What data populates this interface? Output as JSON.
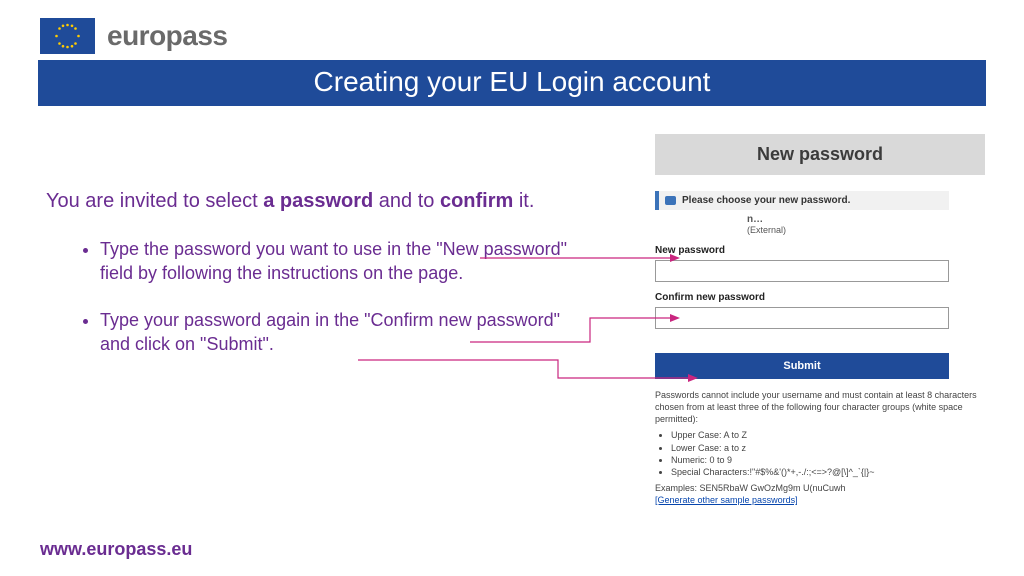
{
  "brand": "europass",
  "title": "Creating your EU Login account",
  "intro": {
    "pre": "You are invited to select ",
    "bold1": "a password",
    "mid": " and to ",
    "bold2": "confirm",
    "post": " it."
  },
  "bullets": [
    "Type the password you want to use in the \"New password\" field by following the instructions on the page.",
    "Type your password again in the \"Confirm new password\" and click on \"Submit\"."
  ],
  "panel": {
    "title": "New password",
    "banner": "Please choose your new password.",
    "meta_name": "n…",
    "meta_ext": "(External)",
    "label_new": "New password",
    "label_confirm": "Confirm new password",
    "submit": "Submit",
    "rules_intro": "Passwords cannot include your username and must contain at least 8 characters chosen from at least three of the following four character groups (white space permitted):",
    "rule_items": [
      "Upper Case: A to Z",
      "Lower Case: a to z",
      "Numeric: 0 to 9",
      "Special Characters:!\"#$%&'()*+,-./:;<=>?@[\\]^_`{|}~"
    ],
    "examples": "Examples: SEN5RbaW GwOzMg9m U(nuCuwh",
    "gen_link": "[Generate other sample passwords]"
  },
  "footer": "www.europass.eu"
}
